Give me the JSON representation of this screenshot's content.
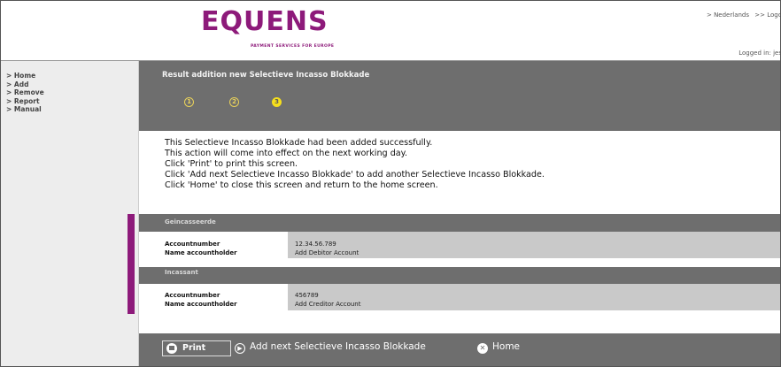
{
  "header": {
    "logo_text": "EQUENS",
    "logo_tagline": "PAYMENT SERVICES FOR EUROPE",
    "links": [
      "> Nederlands",
      ">> Logo"
    ],
    "logged_in": "Logged in: jes"
  },
  "sidebar": {
    "items": [
      {
        "label": "> Home"
      },
      {
        "label": "> Add"
      },
      {
        "label": "> Remove"
      },
      {
        "label": "> Report"
      },
      {
        "label": "> Manual"
      }
    ]
  },
  "banner": {
    "title": "Result addition new Selectieve Incasso Blokkade",
    "steps": [
      "1",
      "2",
      "3"
    ],
    "active_step": 3
  },
  "message": {
    "lines": [
      "This Selectieve Incasso Blokkade had been added successfully.",
      "This action will come into effect on the next working day.",
      "Click 'Print' to print this screen.",
      "Click 'Add next Selectieve Incasso Blokkade' to add another Selectieve Incasso Blokkade.",
      "Click 'Home' to close this screen and return to the home screen."
    ]
  },
  "sections": [
    {
      "title": "Geincasseerde",
      "fields": [
        {
          "label": "Accountnumber",
          "value": "12.34.56.789"
        },
        {
          "label": "Name accountholder",
          "value": "Add Debitor Account"
        }
      ]
    },
    {
      "title": "Incassant",
      "fields": [
        {
          "label": "Accountnumber",
          "value": "456789"
        },
        {
          "label": "Name accountholder",
          "value": "Add Creditor Account"
        }
      ]
    }
  ],
  "footer": {
    "print_label": "Print",
    "add_next_label": "Add next Selectieve Incasso Blokkade",
    "home_label": "Home"
  },
  "colors": {
    "brand": "#8d1a7a",
    "banner": "#6e6e6e",
    "step_active": "#f6df1d"
  }
}
